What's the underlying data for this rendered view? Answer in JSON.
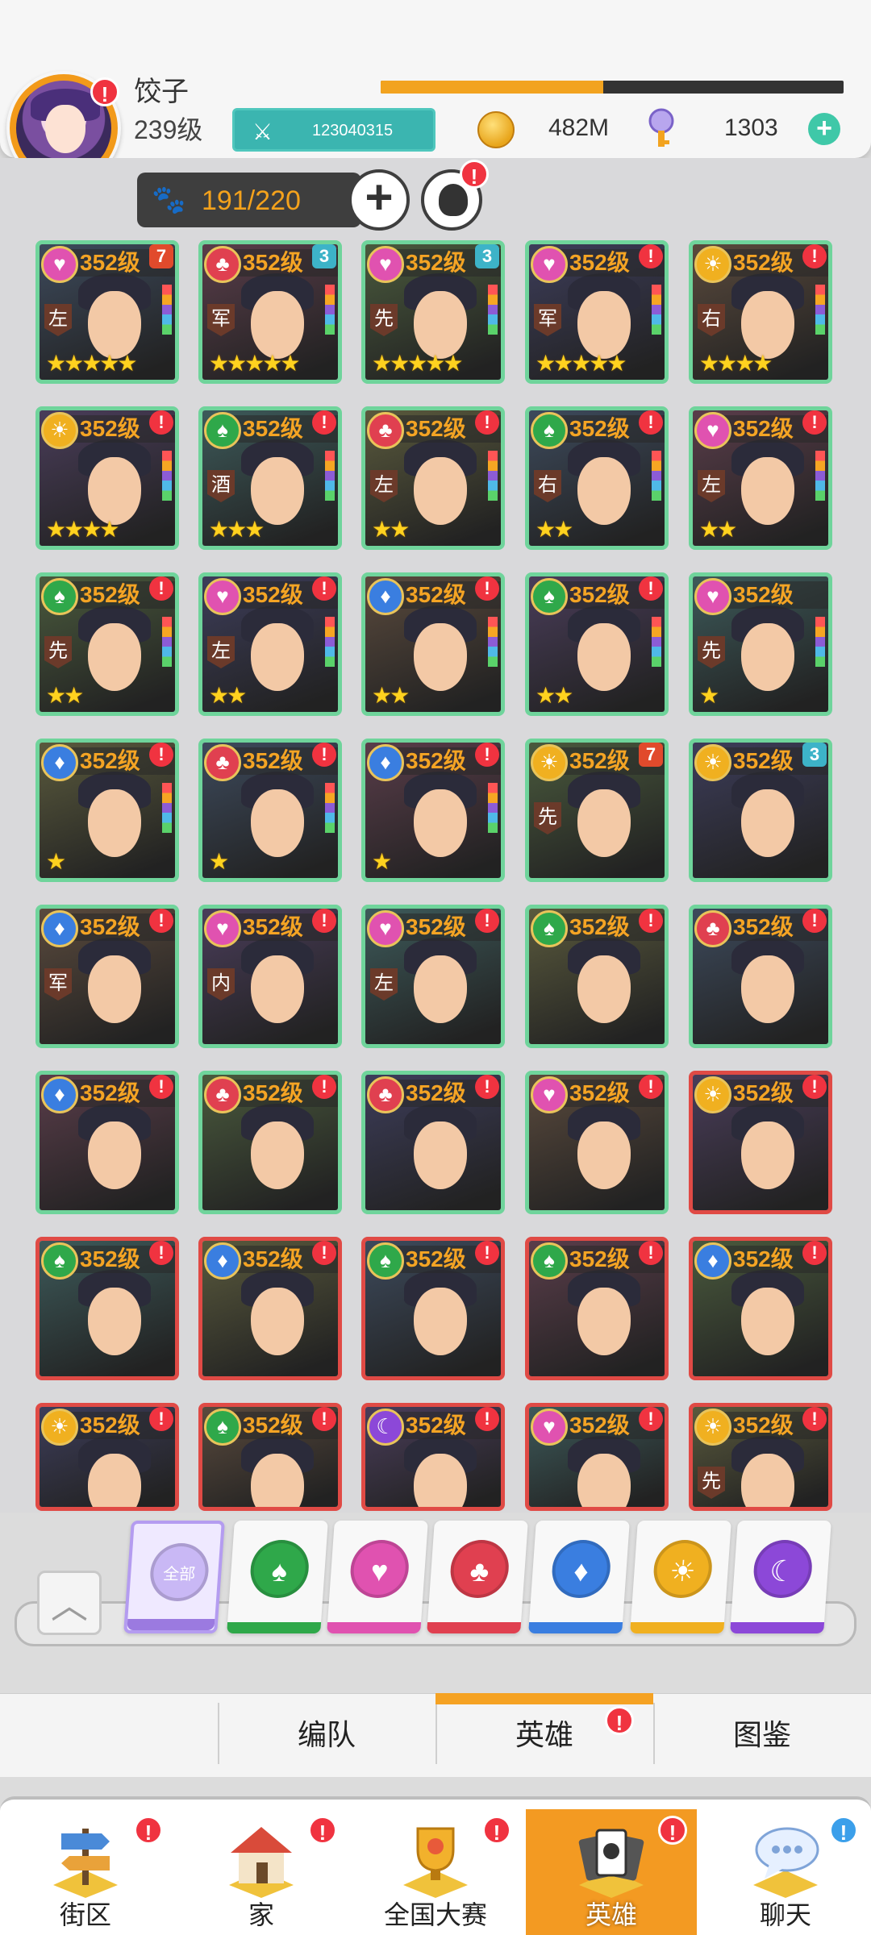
{
  "player": {
    "name": "饺子",
    "level": "239级",
    "id": "123040315",
    "xp_fraction": 0.48
  },
  "resources": {
    "gold": "482M",
    "gems": "1303"
  },
  "capacity": "191/220",
  "heroes": [
    {
      "level": "352级",
      "suit": "heart",
      "pos": "左",
      "stars": 5,
      "badge": "7",
      "frame": "green"
    },
    {
      "level": "352级",
      "suit": "club",
      "pos": "军",
      "stars": 5,
      "badge": "3",
      "frame": "green"
    },
    {
      "level": "352级",
      "suit": "heart",
      "pos": "先",
      "stars": 5,
      "badge": "3",
      "frame": "green"
    },
    {
      "level": "352级",
      "suit": "heart",
      "pos": "军",
      "stars": 5,
      "badge": "!",
      "frame": "green"
    },
    {
      "level": "352级",
      "suit": "sun",
      "pos": "右",
      "stars": 4,
      "badge": "!",
      "frame": "green"
    },
    {
      "level": "352级",
      "suit": "sun",
      "pos": "",
      "stars": 4,
      "badge": "!",
      "frame": "green"
    },
    {
      "level": "352级",
      "suit": "spade",
      "pos": "酒",
      "stars": 3,
      "badge": "!",
      "frame": "green"
    },
    {
      "level": "352级",
      "suit": "club",
      "pos": "左",
      "stars": 2,
      "badge": "!",
      "frame": "green"
    },
    {
      "level": "352级",
      "suit": "spade",
      "pos": "右",
      "stars": 2,
      "badge": "!",
      "frame": "green"
    },
    {
      "level": "352级",
      "suit": "heart",
      "pos": "左",
      "stars": 2,
      "badge": "!",
      "frame": "green"
    },
    {
      "level": "352级",
      "suit": "spade",
      "pos": "先",
      "stars": 2,
      "badge": "!",
      "frame": "green"
    },
    {
      "level": "352级",
      "suit": "heart",
      "pos": "左",
      "stars": 2,
      "badge": "!",
      "frame": "green"
    },
    {
      "level": "352级",
      "suit": "diamond",
      "pos": "",
      "stars": 2,
      "badge": "!",
      "frame": "green"
    },
    {
      "level": "352级",
      "suit": "spade",
      "pos": "",
      "stars": 2,
      "badge": "!",
      "frame": "green"
    },
    {
      "level": "352级",
      "suit": "heart",
      "pos": "先",
      "stars": 1,
      "badge": "",
      "frame": "green"
    },
    {
      "level": "352级",
      "suit": "diamond",
      "pos": "",
      "stars": 1,
      "badge": "!",
      "frame": "green"
    },
    {
      "level": "352级",
      "suit": "club",
      "pos": "",
      "stars": 1,
      "badge": "!",
      "frame": "green"
    },
    {
      "level": "352级",
      "suit": "diamond",
      "pos": "",
      "stars": 1,
      "badge": "!",
      "frame": "green"
    },
    {
      "level": "352级",
      "suit": "sun",
      "pos": "先",
      "stars": 0,
      "badge": "7",
      "frame": "green"
    },
    {
      "level": "352级",
      "suit": "sun",
      "pos": "",
      "stars": 0,
      "badge": "3",
      "frame": "green"
    },
    {
      "level": "352级",
      "suit": "diamond",
      "pos": "军",
      "stars": 0,
      "badge": "!",
      "frame": "green"
    },
    {
      "level": "352级",
      "suit": "heart",
      "pos": "内",
      "stars": 0,
      "badge": "!",
      "frame": "green"
    },
    {
      "level": "352级",
      "suit": "heart",
      "pos": "左",
      "stars": 0,
      "badge": "!",
      "frame": "green"
    },
    {
      "level": "352级",
      "suit": "spade",
      "pos": "",
      "stars": 0,
      "badge": "!",
      "frame": "green"
    },
    {
      "level": "352级",
      "suit": "club",
      "pos": "",
      "stars": 0,
      "badge": "!",
      "frame": "green"
    },
    {
      "level": "352级",
      "suit": "diamond",
      "pos": "",
      "stars": 0,
      "badge": "!",
      "frame": "green"
    },
    {
      "level": "352级",
      "suit": "club",
      "pos": "",
      "stars": 0,
      "badge": "!",
      "frame": "green"
    },
    {
      "level": "352级",
      "suit": "club",
      "pos": "",
      "stars": 0,
      "badge": "!",
      "frame": "green"
    },
    {
      "level": "352级",
      "suit": "heart",
      "pos": "",
      "stars": 0,
      "badge": "!",
      "frame": "green"
    },
    {
      "level": "352级",
      "suit": "sun",
      "pos": "",
      "stars": 0,
      "badge": "!",
      "frame": "red"
    },
    {
      "level": "352级",
      "suit": "spade",
      "pos": "",
      "stars": 0,
      "badge": "!",
      "frame": "red"
    },
    {
      "level": "352级",
      "suit": "diamond",
      "pos": "",
      "stars": 0,
      "badge": "!",
      "frame": "red"
    },
    {
      "level": "352级",
      "suit": "spade",
      "pos": "",
      "stars": 0,
      "badge": "!",
      "frame": "red"
    },
    {
      "level": "352级",
      "suit": "spade",
      "pos": "",
      "stars": 0,
      "badge": "!",
      "frame": "red"
    },
    {
      "level": "352级",
      "suit": "diamond",
      "pos": "",
      "stars": 0,
      "badge": "!",
      "frame": "red"
    },
    {
      "level": "352级",
      "suit": "sun",
      "pos": "",
      "stars": 0,
      "badge": "!",
      "frame": "red"
    },
    {
      "level": "352级",
      "suit": "spade",
      "pos": "",
      "stars": 0,
      "badge": "!",
      "frame": "red"
    },
    {
      "level": "352级",
      "suit": "moon",
      "pos": "",
      "stars": 0,
      "badge": "!",
      "frame": "red"
    },
    {
      "level": "352级",
      "suit": "heart",
      "pos": "",
      "stars": 0,
      "badge": "!",
      "frame": "red"
    },
    {
      "level": "352级",
      "suit": "sun",
      "pos": "先",
      "stars": 0,
      "badge": "!",
      "frame": "red"
    }
  ],
  "filters": [
    {
      "name": "all",
      "label": "全部",
      "color": "#9b7ae0",
      "selected": true
    },
    {
      "name": "spade",
      "label": "",
      "color": "#2fa84a",
      "selected": false
    },
    {
      "name": "heart",
      "label": "",
      "color": "#e052b0",
      "selected": false
    },
    {
      "name": "club",
      "label": "",
      "color": "#e04050",
      "selected": false
    },
    {
      "name": "diamond",
      "label": "",
      "color": "#3a7ee0",
      "selected": false
    },
    {
      "name": "sun",
      "label": "",
      "color": "#f0b020",
      "selected": false
    },
    {
      "name": "moon",
      "label": "",
      "color": "#8c48d8",
      "selected": false
    }
  ],
  "subtabs": {
    "formation": "编队",
    "heroes": "英雄",
    "handbook": "图鉴"
  },
  "nav": {
    "street": "街区",
    "home": "家",
    "tournament": "全国大赛",
    "heroes": "英雄",
    "chat": "聊天"
  },
  "colors": {
    "accent": "#f39a22",
    "badge_red": "#f03340"
  }
}
